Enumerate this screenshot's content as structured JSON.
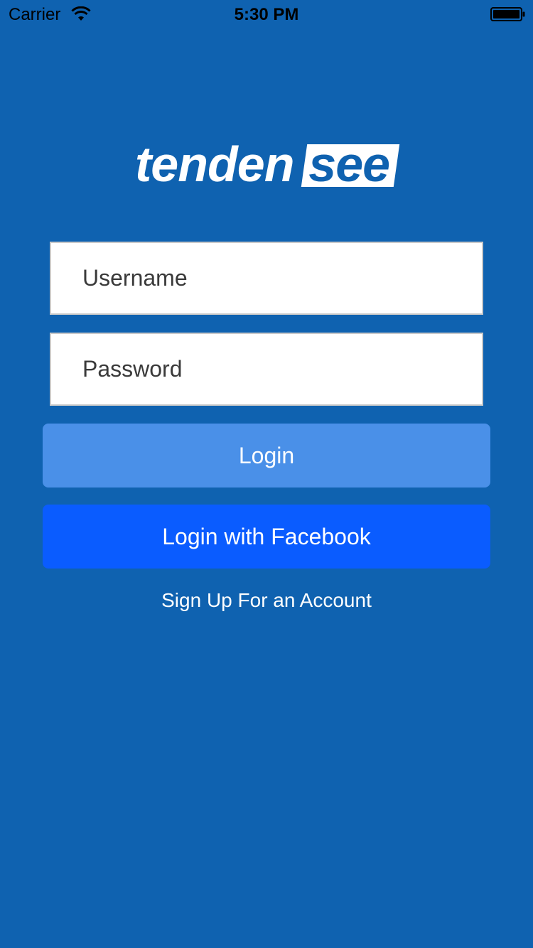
{
  "status_bar": {
    "carrier": "Carrier",
    "time": "5:30 PM",
    "wifi_icon": "wifi-icon",
    "battery_icon": "battery-icon"
  },
  "logo": {
    "text_part1": "tenden",
    "text_part2": "see"
  },
  "form": {
    "username_placeholder": "Username",
    "password_placeholder": "Password",
    "username_value": "",
    "password_value": ""
  },
  "buttons": {
    "login_label": "Login",
    "facebook_label": "Login with Facebook",
    "signup_label": "Sign Up For an Account"
  },
  "colors": {
    "background": "#0f62b0",
    "login_button": "#4a90e8",
    "facebook_button": "#0a5cff",
    "field_background": "#ffffff"
  }
}
